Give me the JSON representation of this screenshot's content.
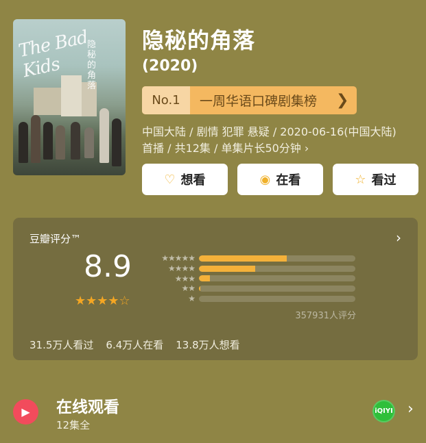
{
  "show": {
    "title": "隐秘的角落",
    "year": "(2020)",
    "poster_title_script": "The Bad Kids",
    "poster_cn": "隐秘的角落"
  },
  "rank": {
    "no": "No.1",
    "text": "一周华语口碑剧集榜",
    "chevron": "❯"
  },
  "meta": {
    "line1": "中国大陆 / 剧情 犯罪 悬疑 / 2020-06-16(中国大陆)",
    "line2": "首播 / 共12集 / 单集片长50分钟 ›"
  },
  "actions": [
    {
      "label": "想看",
      "icon": "heart-plus-icon",
      "glyph": "♡"
    },
    {
      "label": "在看",
      "icon": "target-icon",
      "glyph": "◉"
    },
    {
      "label": "看过",
      "icon": "star-outline-icon",
      "glyph": "☆"
    }
  ],
  "rating": {
    "title": "豆瓣评分™",
    "score": "8.9",
    "stars_display": "★★★★☆",
    "stars_value": 4.5,
    "distribution": [
      {
        "stars": "★★★★★",
        "fraction": 0.56
      },
      {
        "stars": "★★★★",
        "fraction": 0.36
      },
      {
        "stars": "★★★",
        "fraction": 0.07
      },
      {
        "stars": "★★",
        "fraction": 0.01
      },
      {
        "stars": "★",
        "fraction": 0.0
      }
    ],
    "votes": "357931人评分",
    "stats": [
      "31.5万人看过",
      "6.4万人在看",
      "13.8万人想看"
    ]
  },
  "online": {
    "title": "在线观看",
    "subtitle": "12集全",
    "provider": "iQIYI"
  },
  "colors": {
    "background": "#8f8545",
    "card": "#756d40",
    "accent": "#f4b13a",
    "play": "#f24b5c",
    "iqiyi": "#2fbf3a"
  }
}
